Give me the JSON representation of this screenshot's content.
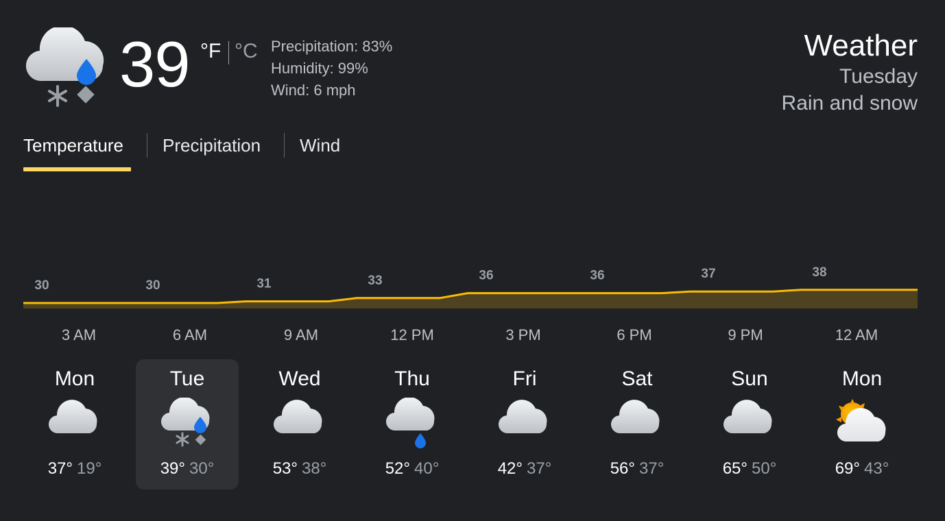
{
  "current": {
    "temperature": "39",
    "unit_f": "°F",
    "unit_c": "°C",
    "precipitation": "Precipitation: 83%",
    "humidity": "Humidity: 99%",
    "wind": "Wind: 6 mph",
    "icon": "rain-snow-icon"
  },
  "header": {
    "title": "Weather",
    "day": "Tuesday",
    "condition": "Rain and snow"
  },
  "tabs": [
    {
      "label": "Temperature",
      "selected": true
    },
    {
      "label": "Precipitation",
      "selected": false
    },
    {
      "label": "Wind",
      "selected": false
    }
  ],
  "colors": {
    "accent": "#fdd663",
    "background": "#202124",
    "selected_card": "#303134",
    "chart_line": "#fbbc04",
    "chart_fill": "#4f4220"
  },
  "chart_data": {
    "type": "area",
    "x": [
      "3 AM",
      "6 AM",
      "9 AM",
      "12 PM",
      "3 PM",
      "6 PM",
      "9 PM",
      "12 AM"
    ],
    "values": [
      30,
      30,
      31,
      33,
      36,
      36,
      37,
      38
    ],
    "ylabel": "",
    "xlabel": ""
  },
  "hours": [
    "3 AM",
    "6 AM",
    "9 AM",
    "12 PM",
    "3 PM",
    "6 PM",
    "9 PM",
    "12 AM"
  ],
  "days": [
    {
      "name": "Mon",
      "hi": "37°",
      "lo": "19°",
      "icon": "cloudy-icon",
      "selected": false
    },
    {
      "name": "Tue",
      "hi": "39°",
      "lo": "30°",
      "icon": "rain-snow-icon",
      "selected": true
    },
    {
      "name": "Wed",
      "hi": "53°",
      "lo": "38°",
      "icon": "cloudy-icon",
      "selected": false
    },
    {
      "name": "Thu",
      "hi": "52°",
      "lo": "40°",
      "icon": "rain-icon",
      "selected": false
    },
    {
      "name": "Fri",
      "hi": "42°",
      "lo": "37°",
      "icon": "cloudy-icon",
      "selected": false
    },
    {
      "name": "Sat",
      "hi": "56°",
      "lo": "37°",
      "icon": "cloudy-icon",
      "selected": false
    },
    {
      "name": "Sun",
      "hi": "65°",
      "lo": "50°",
      "icon": "cloudy-icon",
      "selected": false
    },
    {
      "name": "Mon",
      "hi": "69°",
      "lo": "43°",
      "icon": "partly-cloudy-icon",
      "selected": false
    }
  ]
}
